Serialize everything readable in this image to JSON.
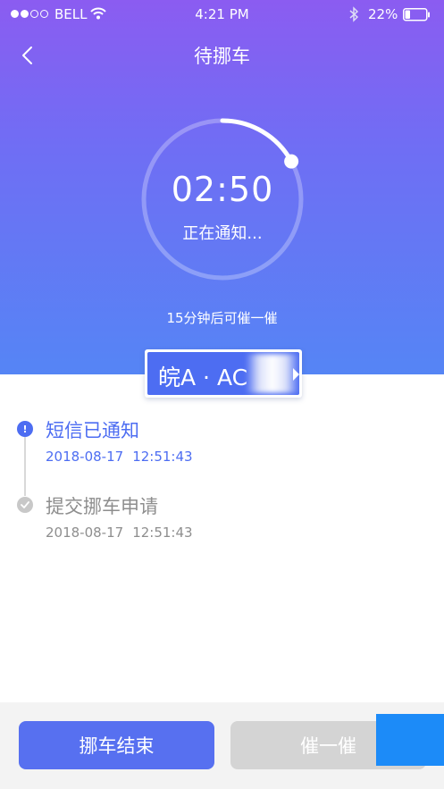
{
  "status_bar": {
    "carrier": "BELL",
    "time": "4:21 PM",
    "battery": "22%",
    "icons": [
      "signal-dots-icon",
      "wifi-icon",
      "bluetooth-icon",
      "battery-icon"
    ]
  },
  "nav": {
    "title": "待挪车",
    "back_icon": "chevron-left-icon"
  },
  "countdown": {
    "time": "02:50",
    "status": "正在通知...",
    "progress_fraction": 0.17
  },
  "remind_hint": "15分钟后可催一催",
  "plate": {
    "text": "皖A · AC"
  },
  "timeline": [
    {
      "title": "短信已通知",
      "date": "2018-08-17",
      "time": "12:51:43",
      "state": "active",
      "icon": "info-icon"
    },
    {
      "title": "提交挪车申请",
      "date": "2018-08-17",
      "time": "12:51:43",
      "state": "done",
      "icon": "check-icon"
    }
  ],
  "buttons": {
    "end_label": "挪车结束",
    "urge_label": "催一催"
  },
  "colors": {
    "accent": "#4d6df2",
    "gradient_top": "#8b5cf1",
    "gradient_bottom": "#5585f5",
    "disabled": "#d4d4d4",
    "overlay": "#1c8bf8"
  }
}
